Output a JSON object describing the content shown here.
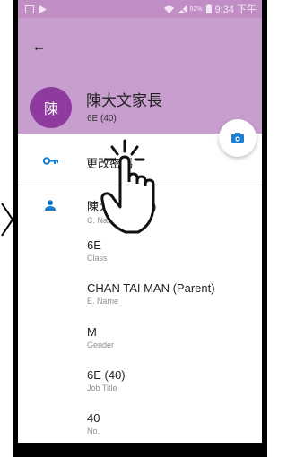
{
  "status_bar": {
    "battery_pct": "92%",
    "time": "9:34 下午"
  },
  "header": {
    "avatar_char": "陳",
    "title": "陳大文家長",
    "subtitle": "6E (40)"
  },
  "password": {
    "label": "更改密碼"
  },
  "fields": [
    {
      "value": "陳大文 (家長)",
      "label": "C. Name"
    },
    {
      "value": "6E",
      "label": "Class"
    },
    {
      "value": "CHAN TAI MAN (Parent)",
      "label": "E. Name"
    },
    {
      "value": "M",
      "label": "Gender"
    },
    {
      "value": "6E (40)",
      "label": "Job Title"
    },
    {
      "value": "40",
      "label": "No."
    }
  ],
  "colors": {
    "header": "#c79ecd",
    "avatar": "#8e3a9e",
    "accent_icon": "#1a7fd1"
  },
  "icons": [
    "back-arrow-icon",
    "key-icon",
    "person-icon",
    "camera-icon",
    "tap-gesture-hand-icon"
  ]
}
